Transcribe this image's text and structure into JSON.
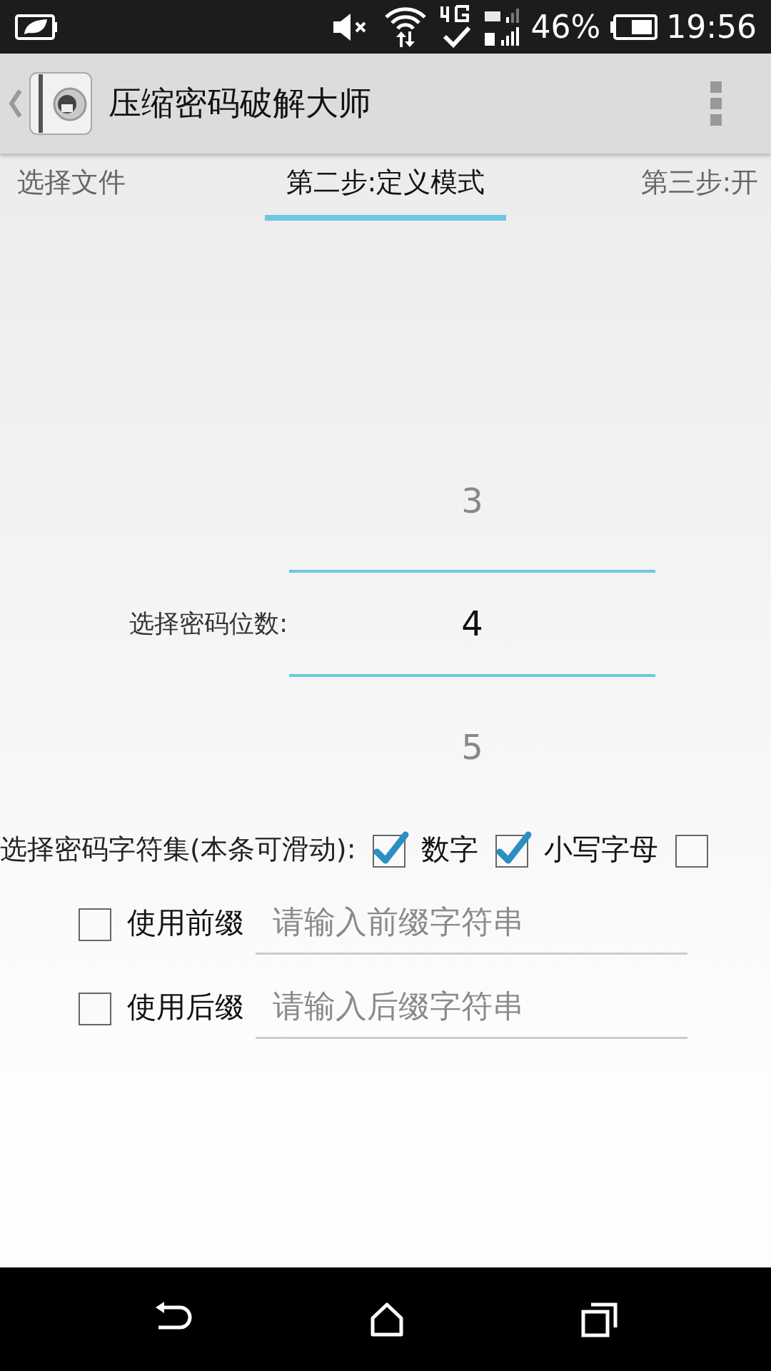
{
  "status_bar": {
    "battery_percent": "46%",
    "time": "19:56"
  },
  "app_bar": {
    "title": "压缩密码破解大师"
  },
  "tabs": [
    {
      "label": "选择文件",
      "selected": false
    },
    {
      "label": "第二步:定义模式",
      "selected": true
    },
    {
      "label": "第三步:开",
      "selected": false
    }
  ],
  "length_picker": {
    "label": "选择密码位数:",
    "options": [
      {
        "value": "3",
        "selected": false
      },
      {
        "value": "4",
        "selected": true
      },
      {
        "value": "5",
        "selected": false
      }
    ]
  },
  "charset": {
    "label": "选择密码字符集(本条可滑动):",
    "options": [
      {
        "label": "数字",
        "checked": true
      },
      {
        "label": "小写字母",
        "checked": true
      },
      {
        "checked": false
      }
    ]
  },
  "affixes": [
    {
      "label": "使用前缀",
      "checked": false,
      "placeholder": "请输入前缀字符串"
    },
    {
      "label": "使用后缀",
      "checked": false,
      "placeholder": "请输入后缀字符串"
    }
  ]
}
